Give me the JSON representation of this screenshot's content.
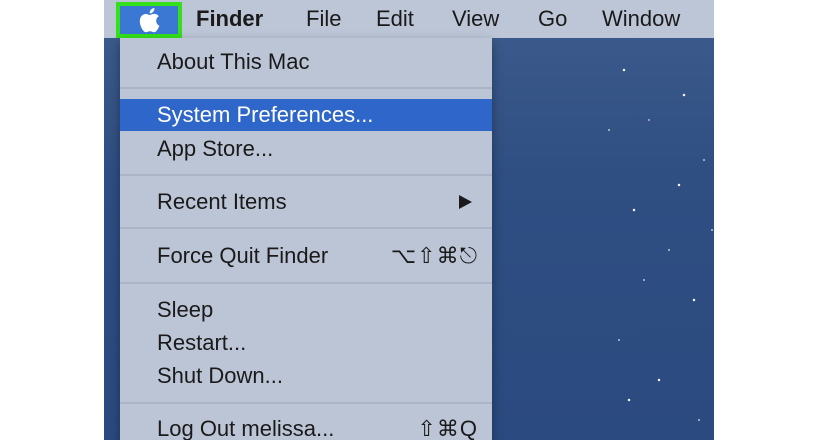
{
  "menubar": {
    "apple_icon": "apple-icon",
    "items": [
      "Finder",
      "File",
      "Edit",
      "View",
      "Go",
      "Window"
    ]
  },
  "apple_menu": {
    "about": "About This Mac",
    "system_preferences": "System Preferences...",
    "app_store": "App Store...",
    "recent_items": "Recent Items",
    "recent_items_arrow": "▶",
    "force_quit": "Force Quit Finder",
    "force_quit_shortcut": "⌥⇧⌘⎋",
    "sleep": "Sleep",
    "restart": "Restart...",
    "shut_down": "Shut Down...",
    "log_out": "Log Out melissa...",
    "log_out_shortcut": "⇧⌘Q"
  },
  "colors": {
    "highlight": "#2e66c9",
    "apple_box_border": "#33e01a",
    "menu_bg": "#bcc5d6",
    "desktop": "#2f4e82"
  }
}
